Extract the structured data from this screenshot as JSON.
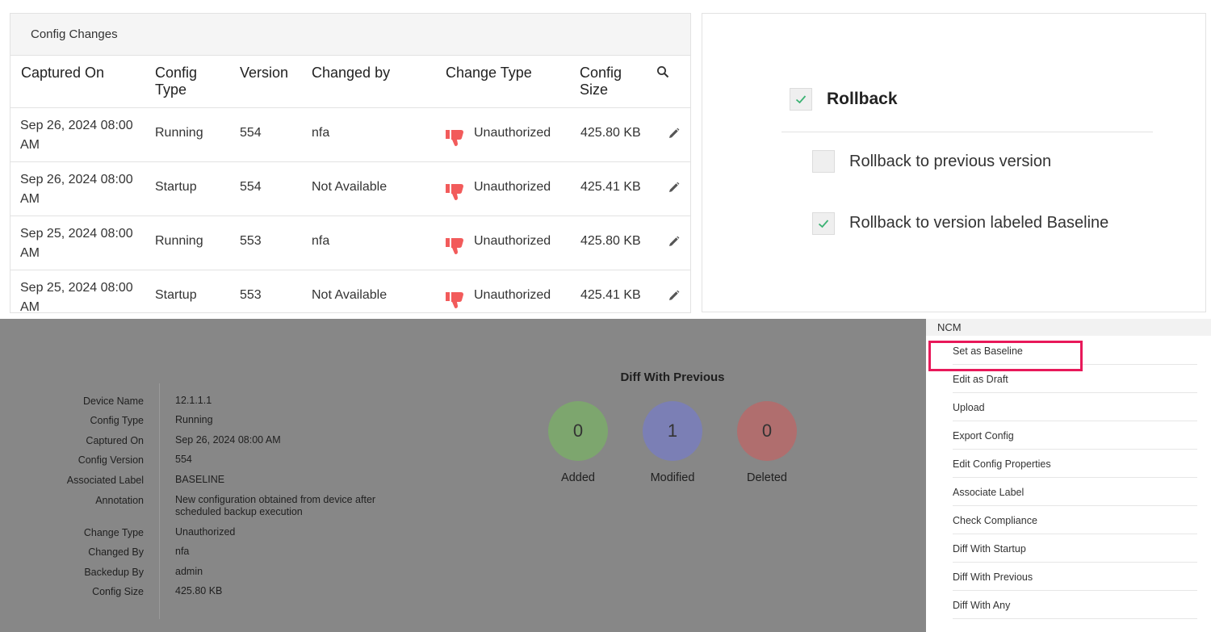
{
  "config_changes": {
    "title": "Config Changes",
    "columns": [
      "Captured On",
      "Config\nType",
      "Version",
      "Changed by",
      "Change Type",
      "Config\nSize"
    ],
    "rows": [
      {
        "captured_on": "Sep 26, 2024 08:00 AM",
        "config_type": "Running",
        "version": "554",
        "changed_by": "nfa",
        "change_type": "Unauthorized",
        "config_size": "425.80 KB"
      },
      {
        "captured_on": "Sep 26, 2024 08:00 AM",
        "config_type": "Startup",
        "version": "554",
        "changed_by": "Not Available",
        "change_type": "Unauthorized",
        "config_size": "425.41 KB"
      },
      {
        "captured_on": "Sep 25, 2024 08:00 AM",
        "config_type": "Running",
        "version": "553",
        "changed_by": "nfa",
        "change_type": "Unauthorized",
        "config_size": "425.80 KB"
      },
      {
        "captured_on": "Sep 25, 2024 08:00 AM",
        "config_type": "Startup",
        "version": "553",
        "changed_by": "Not Available",
        "change_type": "Unauthorized",
        "config_size": "425.41 KB"
      }
    ],
    "icons": {
      "search": "search-icon",
      "thumb": "thumbs-down-icon",
      "edit": "pencil-icon"
    },
    "colors": {
      "thumb": "#f25b5b"
    }
  },
  "rollback": {
    "title": "Rollback",
    "title_checked": true,
    "options": [
      {
        "label": "Rollback to previous version",
        "checked": false
      },
      {
        "label": "Rollback to version labeled Baseline",
        "checked": true
      }
    ],
    "colors": {
      "check": "#3bb273"
    }
  },
  "details": {
    "fields": [
      {
        "label": "Device Name",
        "value": "12.1.1.1"
      },
      {
        "label": "Config Type",
        "value": "Running"
      },
      {
        "label": "Captured On",
        "value": "Sep 26, 2024 08:00 AM"
      },
      {
        "label": "Config Version",
        "value": "554"
      },
      {
        "label": "Associated Label",
        "value": "BASELINE"
      },
      {
        "label": "Annotation",
        "value": "New configuration obtained from device after scheduled backup execution"
      },
      {
        "label": "Change Type",
        "value": "Unauthorized"
      },
      {
        "label": "Changed By",
        "value": "nfa"
      },
      {
        "label": "Backedup By",
        "value": "admin"
      },
      {
        "label": "Config Size",
        "value": "425.80 KB"
      }
    ]
  },
  "diff": {
    "title": "Diff With Previous",
    "stats": [
      {
        "label": "Added",
        "value": "0",
        "color": "#7da66e"
      },
      {
        "label": "Modified",
        "value": "1",
        "color": "#7b7fb5"
      },
      {
        "label": "Deleted",
        "value": "0",
        "color": "#b06e6e"
      }
    ]
  },
  "ncm_menu": {
    "header": "NCM",
    "items": [
      "Set as Baseline",
      "Edit as Draft",
      "Upload",
      "Export Config",
      "Edit Config Properties",
      "Associate Label",
      "Check Compliance",
      "Diff With Startup",
      "Diff With Previous",
      "Diff With Any"
    ],
    "highlighted_index": 0,
    "colors": {
      "highlight": "#e8195a"
    }
  }
}
